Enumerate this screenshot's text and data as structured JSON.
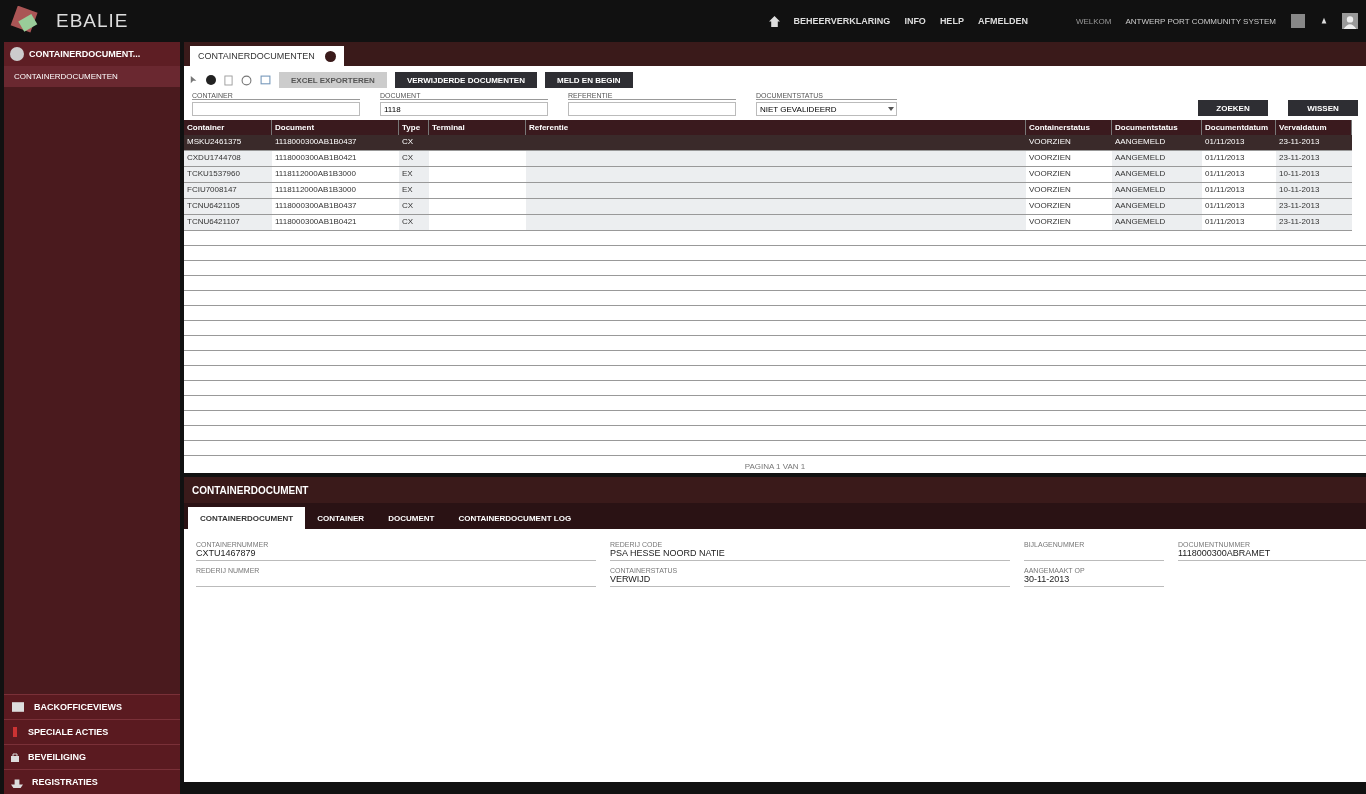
{
  "header": {
    "logo": "EBALIE",
    "nav": [
      "BEHEERVERKLARING",
      "INFO",
      "HELP",
      "AFMELDEN"
    ],
    "welcome": "WELKOM",
    "user": "ANTWERP PORT COMMUNITY SYSTEM"
  },
  "sidebar": {
    "section": "CONTAINERDOCUMENT...",
    "items": [
      {
        "label": "CONTAINERDOCUMENTEN",
        "selected": true
      }
    ],
    "bottom": [
      {
        "label": "BACKOFFICEVIEWS",
        "kind": "window"
      },
      {
        "label": "SPECIALE ACTIES",
        "kind": "bottle"
      },
      {
        "label": "BEVEILIGING",
        "kind": "lock"
      },
      {
        "label": "REGISTRATIES",
        "kind": "ship"
      }
    ]
  },
  "tab": {
    "label": "CONTAINERDOCUMENTEN"
  },
  "toolbar": {
    "buttons": [
      {
        "label": "EXCEL EXPORTEREN",
        "disabled": true
      },
      {
        "label": "VERWIJDERDE DOCUMENTEN",
        "disabled": false
      },
      {
        "label": "MELD EN BEGIN",
        "disabled": false
      }
    ]
  },
  "filters": [
    {
      "label": "CONTAINER",
      "kind": "text"
    },
    {
      "label": "DOCUMENT",
      "value": "1118",
      "kind": "text"
    },
    {
      "label": "REFERENTIE",
      "kind": "text"
    },
    {
      "label": "DOCUMENTSTATUS",
      "value": "NIET GEVALIDEERD",
      "kind": "select"
    }
  ],
  "actions": [
    "ZOEKEN",
    "WISSEN"
  ],
  "table": {
    "columns": [
      "Container",
      "Document",
      "Type",
      "Terminal",
      "Referentie",
      "Containerstatus",
      "Documentstatus",
      "Documentdatum",
      "Vervaldatum"
    ],
    "rows": [
      {
        "selected": true,
        "cells": [
          "MSKU2461375",
          "1118000300AB1B0437",
          "CX",
          "",
          "",
          "VOORZIEN",
          "AANGEMELD",
          "01/11/2013",
          "23-11-2013"
        ]
      },
      {
        "selected": false,
        "cells": [
          "CXDU1744708",
          "1118000300AB1B0421",
          "CX",
          "",
          "",
          "VOORZIEN",
          "AANGEMELD",
          "01/11/2013",
          "23-11-2013"
        ]
      },
      {
        "selected": false,
        "cells": [
          "TCKU1537960",
          "1118112000AB1B3000",
          "EX",
          "",
          "",
          "VOORZIEN",
          "AANGEMELD",
          "01/11/2013",
          "10-11-2013"
        ]
      },
      {
        "selected": false,
        "cells": [
          "FCIU7008147",
          "1118112000AB1B3000",
          "EX",
          "",
          "",
          "VOORZIEN",
          "AANGEMELD",
          "01/11/2013",
          "10-11-2013"
        ]
      },
      {
        "selected": false,
        "cells": [
          "TCNU6421105",
          "1118000300AB1B0437",
          "CX",
          "",
          "",
          "VOORZIEN",
          "AANGEMELD",
          "01/11/2013",
          "23-11-2013"
        ]
      },
      {
        "selected": false,
        "cells": [
          "TCNU6421107",
          "1118000300AB1B0421",
          "CX",
          "",
          "",
          "VOORZIEN",
          "AANGEMELD",
          "01/11/2013",
          "23-11-2013"
        ]
      }
    ]
  },
  "pager": "PAGINA 1 VAN 1",
  "detail": {
    "title": "CONTAINERDOCUMENT",
    "tabs": [
      {
        "label": "CONTAINERDOCUMENT",
        "selected": true
      },
      {
        "label": "CONTAINER",
        "selected": false
      },
      {
        "label": "DOCUMENT",
        "selected": false
      },
      {
        "label": "CONTAINERDOCUMENT LOG",
        "selected": false
      }
    ],
    "fields": [
      {
        "label": "CONTAINERNUMMER",
        "value": "CXTU1467879"
      },
      {
        "label": "REDERIJ CODE",
        "value": "PSA HESSE NOORD NATIE"
      },
      {
        "label": "BIJLAGENUMMER"
      },
      {
        "label": "DOCUMENTNUMMER",
        "value": "1118000300ABRAMET"
      },
      {
        "label": "REDERIJ NUMMER"
      },
      {
        "label": "CONTAINERSTATUS",
        "value": "VERWIJD"
      },
      {
        "label": "AANGEMAAKT OP",
        "value": "30-11-2013"
      }
    ]
  }
}
